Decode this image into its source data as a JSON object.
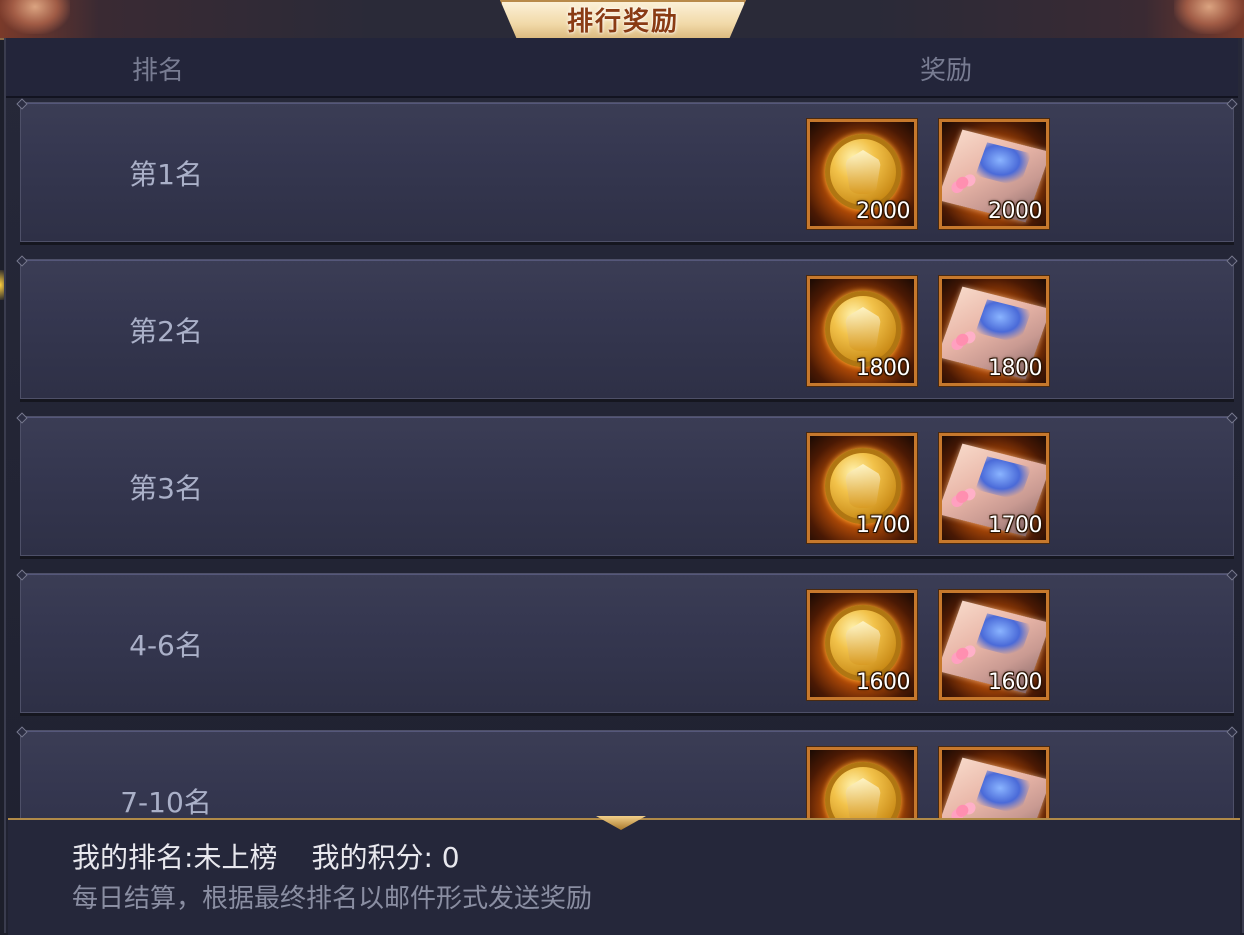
{
  "title": "排行奖励",
  "header": {
    "rank_col": "排名",
    "reward_col": "奖励"
  },
  "rows": [
    {
      "rank": "第1名",
      "rewards": [
        {
          "icon": "gold-coin-icon",
          "qty": "2000"
        },
        {
          "icon": "map-scroll-icon",
          "qty": "2000"
        }
      ]
    },
    {
      "rank": "第2名",
      "rewards": [
        {
          "icon": "gold-coin-icon",
          "qty": "1800"
        },
        {
          "icon": "map-scroll-icon",
          "qty": "1800"
        }
      ]
    },
    {
      "rank": "第3名",
      "rewards": [
        {
          "icon": "gold-coin-icon",
          "qty": "1700"
        },
        {
          "icon": "map-scroll-icon",
          "qty": "1700"
        }
      ]
    },
    {
      "rank": "4-6名",
      "rewards": [
        {
          "icon": "gold-coin-icon",
          "qty": "1600"
        },
        {
          "icon": "map-scroll-icon",
          "qty": "1600"
        }
      ]
    },
    {
      "rank": "7-10名",
      "rewards": [
        {
          "icon": "gold-coin-icon",
          "qty": ""
        },
        {
          "icon": "map-scroll-icon",
          "qty": ""
        }
      ]
    }
  ],
  "footer": {
    "my_rank_label": "我的排名:",
    "my_rank_value": "未上榜",
    "my_score_label": "我的积分:",
    "my_score_value": "0",
    "note": "每日结算，根据最终排名以邮件形式发送奖励"
  },
  "colors": {
    "accent_gold": "#c6782c",
    "title_text": "#8a3b14",
    "panel_bg": "#262839"
  }
}
